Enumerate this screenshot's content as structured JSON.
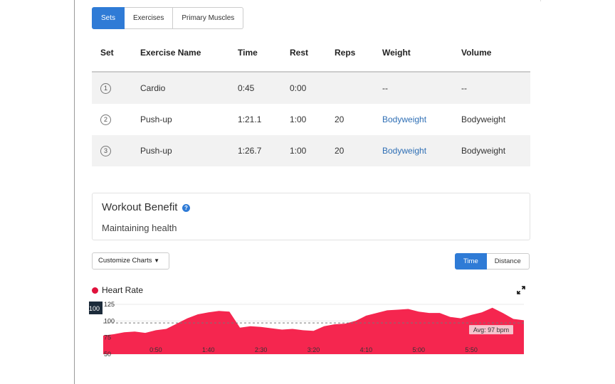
{
  "tabs": [
    "Sets",
    "Exercises",
    "Primary Muscles"
  ],
  "active_tab": 0,
  "table": {
    "headers": [
      "Set",
      "Exercise Name",
      "Time",
      "Rest",
      "Reps",
      "Weight",
      "Volume"
    ],
    "rows": [
      {
        "set": "1",
        "name": "Cardio",
        "time": "0:45",
        "rest": "0:00",
        "reps": "",
        "weight": "--",
        "volume": "--"
      },
      {
        "set": "2",
        "name": "Push-up",
        "time": "1:21.1",
        "rest": "1:00",
        "reps": "20",
        "weight": "Bodyweight",
        "volume": "Bodyweight"
      },
      {
        "set": "3",
        "name": "Push-up",
        "time": "1:26.7",
        "rest": "1:00",
        "reps": "20",
        "weight": "Bodyweight",
        "volume": "Bodyweight"
      }
    ]
  },
  "benefit": {
    "title": "Workout Benefit",
    "help_glyph": "?",
    "value": "Maintaining health"
  },
  "controls": {
    "customize_label": "Customize Charts",
    "caret": "▼",
    "toggle": [
      "Time",
      "Distance"
    ],
    "toggle_active": 0
  },
  "chart_data": {
    "type": "area",
    "title": "Heart Rate",
    "color": "#f5264f",
    "x_ticks": [
      "0:50",
      "1:40",
      "2:30",
      "3:20",
      "4:10",
      "5:00",
      "5:50"
    ],
    "y_ticks": [
      "50",
      "75",
      "100",
      "125"
    ],
    "ylim": [
      50,
      125
    ],
    "cursor_value": "100",
    "avg_label": "Avg: 97 bpm",
    "avg_value": 97,
    "x_seconds": [
      0,
      10,
      20,
      30,
      40,
      50,
      60,
      70,
      80,
      90,
      100,
      110,
      120,
      130,
      140,
      150,
      160,
      170,
      180,
      190,
      200,
      210,
      220,
      230,
      240,
      250,
      260,
      270,
      280,
      290,
      300,
      310,
      320,
      330,
      340,
      350,
      360,
      370,
      380,
      390,
      400
    ],
    "values": [
      78,
      80,
      83,
      84,
      82,
      86,
      88,
      96,
      104,
      110,
      113,
      115,
      114,
      90,
      92,
      91,
      89,
      87,
      88,
      86,
      85,
      92,
      95,
      96,
      100,
      108,
      112,
      116,
      117,
      118,
      114,
      112,
      112,
      106,
      104,
      109,
      113,
      120,
      112,
      103,
      101
    ]
  }
}
